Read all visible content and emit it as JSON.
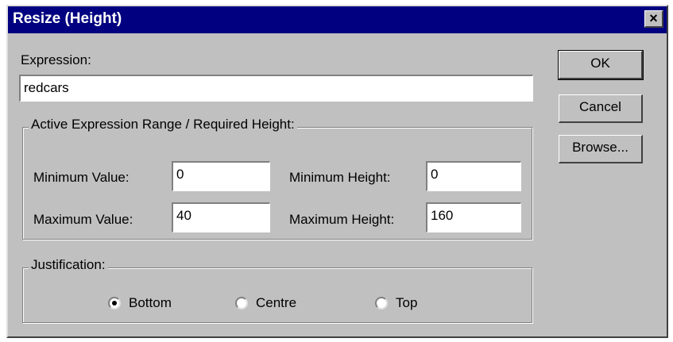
{
  "dialog": {
    "title": "Resize (Height)",
    "close_label": "×"
  },
  "expression": {
    "label": "Expression:",
    "value": "redcars"
  },
  "buttons": {
    "ok": "OK",
    "cancel": "Cancel",
    "browse": "Browse..."
  },
  "range": {
    "title": "Active Expression Range / Required Height:",
    "min_value_label": "Minimum Value:",
    "min_value": "0",
    "max_value_label": "Maximum Value:",
    "max_value": "40",
    "min_height_label": "Minimum Height:",
    "min_height": "0",
    "max_height_label": "Maximum Height:",
    "max_height": "160"
  },
  "justification": {
    "title": "Justification:",
    "options": [
      "Bottom",
      "Centre",
      "Top"
    ],
    "selected": "Bottom"
  }
}
